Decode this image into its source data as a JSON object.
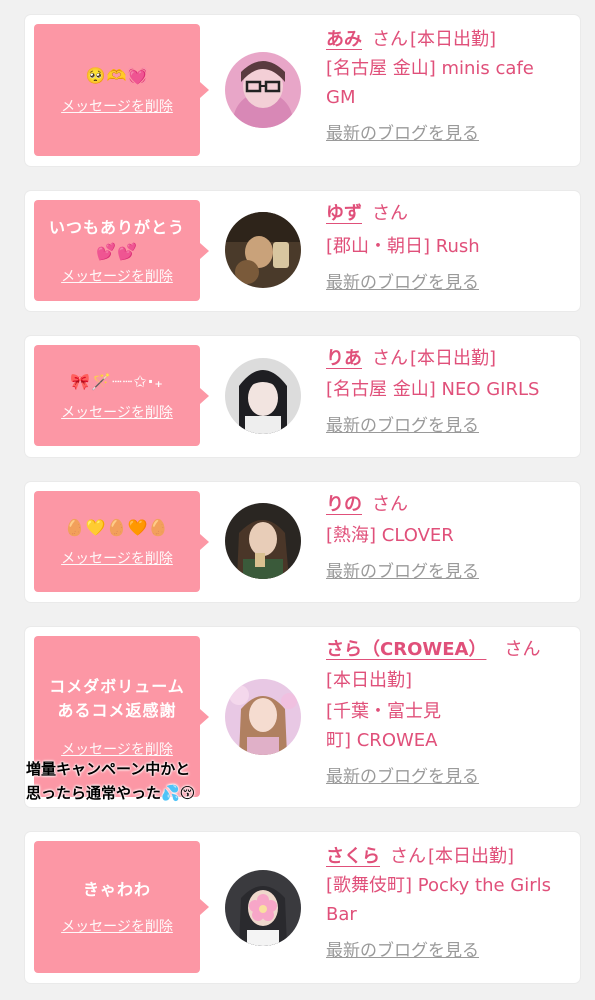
{
  "delete_label": "メッセージを削除",
  "honorific": "さん",
  "blog_link": "最新のブログを見る",
  "cards": [
    {
      "message": "🥺🫶💓",
      "name": "あみ",
      "status": "[本日出勤]",
      "shop": "[名古屋 金山] minis cafe GM"
    },
    {
      "message": "いつもありがとう\n💕💕",
      "name": "ゆず",
      "status": "",
      "shop": "[郡山・朝日] Rush"
    },
    {
      "message": "🎀🪄┈┈✩‧₊",
      "name": "りあ",
      "status": "[本日出勤]",
      "shop": "[名古屋 金山] NEO GIRLS"
    },
    {
      "message": "🥚💛🥚🧡🥚",
      "name": "りの",
      "status": "",
      "shop": "[熱海] CLOVER"
    },
    {
      "message": "コメダボリューム\nあるコメ返感謝",
      "name": "さら（CROWEA）",
      "status": "[本日出勤]",
      "shop": "[千葉・富士見町] CROWEA"
    },
    {
      "message": "きゃわわ",
      "name": "さくら",
      "status": "[本日出勤]",
      "shop": "[歌舞伎町] Pocky the Girls Bar"
    }
  ],
  "overlay_caption": "増量キャンペーン中かと\n思ったら通常やった💦😚",
  "colors": {
    "bubble": "#fc97a5",
    "accent": "#e0507a",
    "link": "#9a9a9a"
  }
}
